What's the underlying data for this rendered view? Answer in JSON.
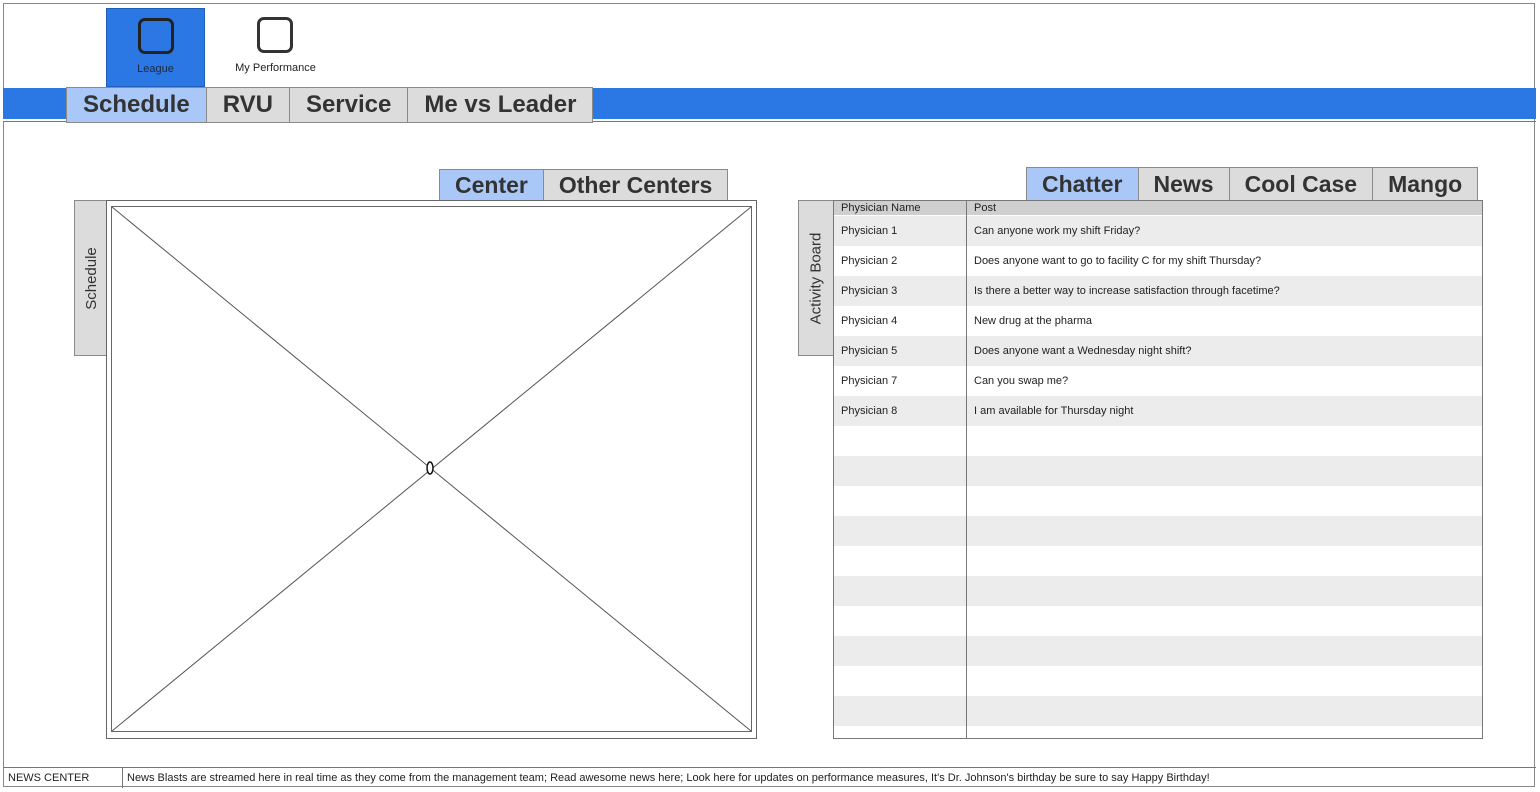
{
  "top_nav": [
    {
      "label": "League",
      "icon": "square-icon",
      "active": true
    },
    {
      "label": "My Performance",
      "icon": "square-icon",
      "active": false
    }
  ],
  "main_tabs": [
    {
      "label": "Schedule",
      "active": true
    },
    {
      "label": "RVU",
      "active": false
    },
    {
      "label": "Service",
      "active": false
    },
    {
      "label": "Me vs Leader",
      "active": false
    }
  ],
  "schedule_panel": {
    "side_label": "Schedule",
    "tabs": [
      {
        "label": "Center",
        "active": true
      },
      {
        "label": "Other Centers",
        "active": false
      }
    ]
  },
  "activity_panel": {
    "side_label": "Activity Board",
    "tabs": [
      {
        "label": "Chatter",
        "active": true
      },
      {
        "label": "News",
        "active": false
      },
      {
        "label": "Cool Case",
        "active": false
      },
      {
        "label": "Mango",
        "active": false
      }
    ],
    "columns": [
      "Physician Name",
      "Post"
    ],
    "rows": [
      [
        "Physician 1",
        "Can anyone work my shift Friday?"
      ],
      [
        "Physician 2",
        "Does anyone want to go to facility C for my shift Thursday?"
      ],
      [
        "Physician 3",
        "Is there a better way to increase satisfaction through facetime?"
      ],
      [
        "Physician 4",
        "New drug at the pharma"
      ],
      [
        "Physician 5",
        "Does anyone want a Wednesday night shift?"
      ],
      [
        "Physician 7",
        "Can you swap me?"
      ],
      [
        "Physician 8",
        "I am available for Thursday night"
      ]
    ]
  },
  "news_center": {
    "label": "NEWS CENTER",
    "text": "News Blasts are streamed here in real time as they come from the management team; Read awesome news here; Look here for updates on performance measures, It's Dr. Johnson's birthday be sure to say Happy Birthday!"
  },
  "colors": {
    "accent": "#2b78e4",
    "active_tab": "#a9c8f7",
    "inactive_tab": "#dcdcdc"
  }
}
